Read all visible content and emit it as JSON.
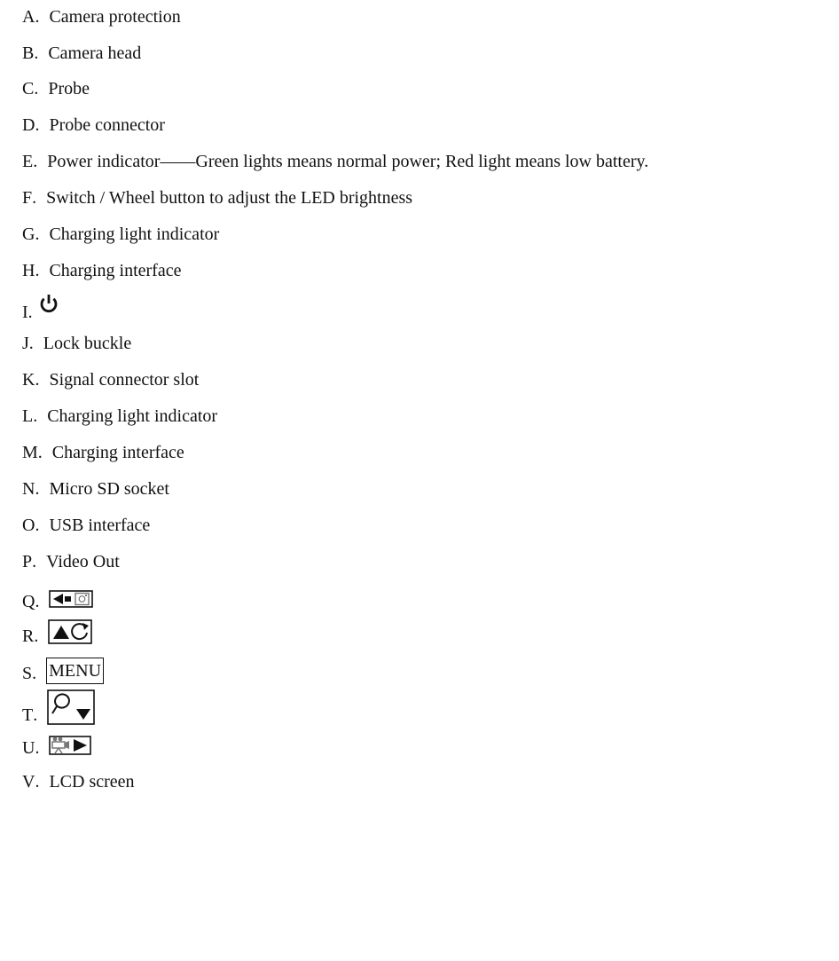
{
  "items": [
    {
      "letter": "A",
      "sep": ".",
      "text": "Camera protection"
    },
    {
      "letter": "B",
      "sep": ".",
      "text": "Camera head"
    },
    {
      "letter": "C",
      "sep": ".",
      "text": "Probe"
    },
    {
      "letter": "D",
      "sep": ".",
      "text": "Probe connector"
    },
    {
      "letter": "E",
      "sep": ".",
      "text": "Power indicator——Green lights means normal power; Red light means low battery."
    },
    {
      "letter": "F",
      "sep": ".",
      "text": "Switch / Wheel button to adjust the LED brightness"
    },
    {
      "letter": "G",
      "sep": ".",
      "text": "Charging light indicator"
    },
    {
      "letter": "H",
      "sep": ".",
      "text": "Charging interface"
    },
    {
      "letter": "I",
      "sep": ".",
      "icon": "power-icon"
    },
    {
      "letter": "J",
      "sep": ".",
      "text": "Lock buckle"
    },
    {
      "letter": "K",
      "sep": ".",
      "text": "Signal connector slot"
    },
    {
      "letter": "L",
      "sep": ".",
      "text": "Charging light indicator"
    },
    {
      "letter": "M",
      "sep": ".",
      "text": "Charging interface"
    },
    {
      "letter": "N",
      "sep": ".",
      "text": "Micro SD socket"
    },
    {
      "letter": "O",
      "sep": ".",
      "text": "USB interface"
    },
    {
      "letter": "P",
      "sep": ".",
      "text": "Video Out"
    },
    {
      "letter": "Q",
      "sep": ".",
      "icon": "left-camera-button-icon"
    },
    {
      "letter": "R",
      "sep": ".",
      "icon": "up-rotate-button-icon"
    },
    {
      "letter": "S",
      "sep": ".",
      "button_label": "MENU"
    },
    {
      "letter": "T",
      "sep": ".",
      "icon": "zoom-down-button-icon"
    },
    {
      "letter": "U",
      "sep": ".",
      "icon": "video-right-button-icon"
    },
    {
      "letter": "V",
      "sep": ".",
      "text": "LCD screen"
    }
  ]
}
